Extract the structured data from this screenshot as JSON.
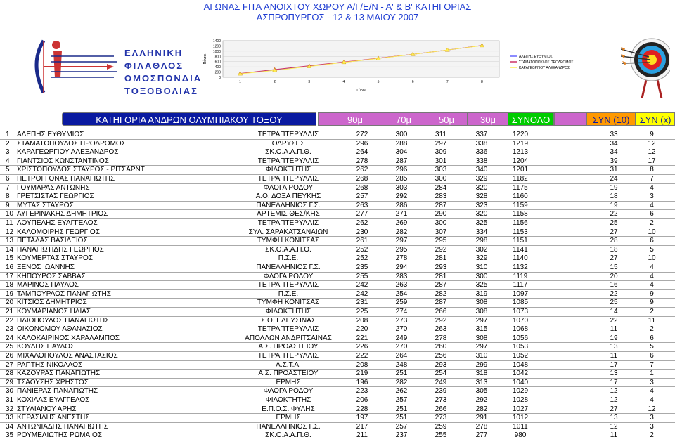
{
  "header": {
    "line1": "ΑΓΩΝΑΣ FITA ΑΝΟΙΧΤΟΥ ΧΩΡΟΥ Α/Γ/Ε/Ν - Α' & Β' ΚΑΤΗΓΟΡΙΑΣ",
    "line2": "ΑΣΠΡΟΠΥΡΓΟΣ - 12 & 13 ΜΑΙΟΥ 2007"
  },
  "logo": {
    "line1": "ΕΛΛΗΝΙΚΗ",
    "line2": "ΦΙΛΑΘΛΟΣ",
    "line3": "ΟΜΟΣΠΟΝΔΙΑ",
    "line4": "ΤΟΞΟΒΟΛΙΑΣ"
  },
  "colors": {
    "title": "#1e3cd2",
    "category_bg": "#0a1aa0",
    "category_text": "#ffffff",
    "distance_bg": "#cc66cc",
    "distance_text": "#ffffff",
    "total_bg": "#00cc00",
    "x10_bg": "#ff9900",
    "x_bg": "#ffff00"
  },
  "columns": {
    "category": "ΚΑΤΗΓΟΡΙΑ ΑΝΔΡΩΝ ΟΛΥΜΠΙΑΚΟΥ ΤΟΞΟΥ",
    "d90": "90μ",
    "d70": "70μ",
    "d50": "50μ",
    "d30": "30μ",
    "total": "ΣΥΝΟΛΟ",
    "x10": "ΣΥΝ (10)",
    "x": "ΣΥΝ (x)"
  },
  "chart_data": {
    "type": "line",
    "xlabel": "Γύροι",
    "ylabel": "Πόντοι",
    "ylim": [
      0,
      1400
    ],
    "yticks": [
      "0",
      "200",
      "400",
      "600",
      "800",
      "1000",
      "1200",
      "1400"
    ],
    "categories": [
      "1",
      "2",
      "3",
      "4",
      "5",
      "6",
      "7",
      "8"
    ],
    "series": [
      {
        "name": "ΑΛΕΠΗΣ ΕΥΘΥΜΙΟΣ",
        "color": "#6666ff",
        "values": [
          140,
          272,
          420,
          572,
          723,
          883,
          1043,
          1220
        ]
      },
      {
        "name": "ΣΤΑΜΑΤΟΠΟΥΛΟΣ ΠΡΟΔΡΟΜΟΣ",
        "color": "#cc3366",
        "values": [
          145,
          296,
          440,
          584,
          730,
          881,
          1045,
          1219
        ]
      },
      {
        "name": "ΚΑΡΑΓΕΩΡΓΙΟΥ ΑΛΕΞΑΝΔΡΟΣ",
        "color": "#ffee55",
        "values": [
          130,
          264,
          415,
          568,
          720,
          877,
          1045,
          1213
        ]
      }
    ]
  },
  "rows": [
    {
      "rank": "1",
      "name": "ΑΛΕΠΗΣ ΕΥΘΥΜΙΟΣ",
      "club": "ΤΕΤΡΑΠΤΕΡΥΛΛΙΣ",
      "s1": "272",
      "s2": "300",
      "s3": "311",
      "s4": "337",
      "total": "1220",
      "x10": "33",
      "x": "9"
    },
    {
      "rank": "2",
      "name": "ΣΤΑΜΑΤΟΠΟΥΛΟΣ ΠΡΟΔΡΟΜΟΣ",
      "club": "ΟΔΡΥΣΕΣ",
      "s1": "296",
      "s2": "288",
      "s3": "297",
      "s4": "338",
      "total": "1219",
      "x10": "34",
      "x": "12"
    },
    {
      "rank": "3",
      "name": "ΚΑΡΑΓΕΩΡΓΙΟΥ ΑΛΕΞΑΝΔΡΟΣ",
      "club": "ΣΚ.Ο.Α.Α.Π.Θ.",
      "s1": "264",
      "s2": "304",
      "s3": "309",
      "s4": "336",
      "total": "1213",
      "x10": "34",
      "x": "12"
    },
    {
      "rank": "4",
      "name": "ΓΙΑΝΤΣΙΟΣ ΚΩΝΣΤΑΝΤΙΝΟΣ",
      "club": "ΤΕΤΡΑΠΤΕΡΥΛΛΙΣ",
      "s1": "278",
      "s2": "287",
      "s3": "301",
      "s4": "338",
      "total": "1204",
      "x10": "39",
      "x": "17"
    },
    {
      "rank": "5",
      "name": "ΧΡΙΣΤΟΠΟΥΛΟΣ ΣΤΑΥΡΟΣ - ΡΙΤΣΑΡΝΤ",
      "club": "ΦΙΛΟΚΤΗΤΗΣ",
      "s1": "262",
      "s2": "296",
      "s3": "303",
      "s4": "340",
      "total": "1201",
      "x10": "31",
      "x": "8"
    },
    {
      "rank": "6",
      "name": "ΠΕΤΡΟΓΓΟΝΑΣ ΠΑΝΑΓΙΩΤΗΣ",
      "club": "ΤΕΤΡΑΠΤΕΡΥΛΛΙΣ",
      "s1": "268",
      "s2": "285",
      "s3": "300",
      "s4": "329",
      "total": "1182",
      "x10": "24",
      "x": "7"
    },
    {
      "rank": "7",
      "name": "ΓΟΥΜΑΡΑΣ ΑΝΤΩΝΗΣ",
      "club": "ΦΛΟΓΑ ΡΟΔΟΥ",
      "s1": "268",
      "s2": "303",
      "s3": "284",
      "s4": "320",
      "total": "1175",
      "x10": "19",
      "x": "4"
    },
    {
      "rank": "8",
      "name": "ΓΡΕΤΣΙΣΤΑΣ ΓΕΩΡΓΙΟΣ",
      "club": "Α.Ο. ΔΟΞΑ ΠΕΥΚΗΣ",
      "s1": "257",
      "s2": "292",
      "s3": "283",
      "s4": "328",
      "total": "1160",
      "x10": "18",
      "x": "3"
    },
    {
      "rank": "9",
      "name": "ΜΥΤΑΣ ΣΤΑΥΡΟΣ",
      "club": "ΠΑΝΕΛΛΗΝΙΟΣ Γ.Σ.",
      "s1": "263",
      "s2": "286",
      "s3": "287",
      "s4": "323",
      "total": "1159",
      "x10": "19",
      "x": "4"
    },
    {
      "rank": "10",
      "name": "ΑΥΓΕΡΙΝΑΚΗΣ ΔΗΜΗΤΡΙΟΣ",
      "club": "ΑΡΤΕΜΙΣ ΘΕΣ/ΚΗΣ",
      "s1": "277",
      "s2": "271",
      "s3": "290",
      "s4": "320",
      "total": "1158",
      "x10": "22",
      "x": "6"
    },
    {
      "rank": "11",
      "name": "ΛΟΥΠΕΛΗΣ ΕΥΑΓΓΕΛΟΣ",
      "club": "ΤΕΤΡΑΠΤΕΡΥΛΛΙΣ",
      "s1": "262",
      "s2": "269",
      "s3": "300",
      "s4": "325",
      "total": "1156",
      "x10": "25",
      "x": "2"
    },
    {
      "rank": "12",
      "name": "ΚΑΛΟΜΟΙΡΗΣ ΓΕΩΡΓΙΟΣ",
      "club": "ΣΥΛ. ΣΑΡΑΚΑΤΣΑΝΑΙΩΝ",
      "s1": "230",
      "s2": "282",
      "s3": "307",
      "s4": "334",
      "total": "1153",
      "x10": "27",
      "x": "10"
    },
    {
      "rank": "13",
      "name": "ΠΕΤΑΛΑΣ ΒΑΣΙΛΕΙΟΣ",
      "club": "ΤΥΜΦΗ ΚΟΝΙΤΣΑΣ",
      "s1": "261",
      "s2": "297",
      "s3": "295",
      "s4": "298",
      "total": "1151",
      "x10": "28",
      "x": "6"
    },
    {
      "rank": "14",
      "name": "ΠΑΝΑΓΙΩΤΙΔΗΣ ΓΕΩΡΓΙΟΣ",
      "club": "ΣΚ.Ο.Α.Α.Π.Θ.",
      "s1": "252",
      "s2": "295",
      "s3": "292",
      "s4": "302",
      "total": "1141",
      "x10": "18",
      "x": "5"
    },
    {
      "rank": "15",
      "name": "ΚΟΥΜΕΡΤΑΣ ΣΤΑΥΡΟΣ",
      "club": "Π.Σ.Ε.",
      "s1": "252",
      "s2": "278",
      "s3": "281",
      "s4": "329",
      "total": "1140",
      "x10": "27",
      "x": "10"
    },
    {
      "rank": "16",
      "name": "ΞΕΝΟΣ ΙΩΑΝΝΗΣ",
      "club": "ΠΑΝΕΛΛΗΝΙΟΣ Γ.Σ.",
      "s1": "235",
      "s2": "294",
      "s3": "293",
      "s4": "310",
      "total": "1132",
      "x10": "15",
      "x": "4"
    },
    {
      "rank": "17",
      "name": "ΚΗΠΟΥΡΟΣ ΣΑΒΒΑΣ",
      "club": "ΦΛΟΓΑ ΡΟΔΟΥ",
      "s1": "255",
      "s2": "283",
      "s3": "281",
      "s4": "300",
      "total": "1119",
      "x10": "20",
      "x": "4"
    },
    {
      "rank": "18",
      "name": "ΜΑΡΙΝΟΣ ΠΑΥΛΟΣ",
      "club": "ΤΕΤΡΑΠΤΕΡΥΛΛΙΣ",
      "s1": "242",
      "s2": "263",
      "s3": "287",
      "s4": "325",
      "total": "1117",
      "x10": "16",
      "x": "4"
    },
    {
      "rank": "19",
      "name": "ΤΑΜΠΟΥΡΛΟΣ ΠΑΝΑΓΙΩΤΗΣ",
      "club": "Π.Σ.Ε.",
      "s1": "242",
      "s2": "254",
      "s3": "282",
      "s4": "319",
      "total": "1097",
      "x10": "22",
      "x": "9"
    },
    {
      "rank": "20",
      "name": "ΚΙΤΣΙΟΣ ΔΗΜΗΤΡΙΟΣ",
      "club": "ΤΥΜΦΗ ΚΟΝΙΤΣΑΣ",
      "s1": "231",
      "s2": "259",
      "s3": "287",
      "s4": "308",
      "total": "1085",
      "x10": "25",
      "x": "9"
    },
    {
      "rank": "21",
      "name": "ΚΟΥΜΑΡΙΑΝΟΣ ΗΛΙΑΣ",
      "club": "ΦΙΛΟΚΤΗΤΗΣ",
      "s1": "225",
      "s2": "274",
      "s3": "266",
      "s4": "308",
      "total": "1073",
      "x10": "14",
      "x": "2"
    },
    {
      "rank": "22",
      "name": "ΗΛΙΟΠΟΥΛΟΣ ΠΑΝΑΓΙΩΤΗΣ",
      "club": "Σ.Ο. ΕΛΕΥΣΙΝΑΣ",
      "s1": "208",
      "s2": "273",
      "s3": "292",
      "s4": "297",
      "total": "1070",
      "x10": "22",
      "x": "11"
    },
    {
      "rank": "23",
      "name": "ΟΙΚΟΝΟΜΟΥ ΑΘΑΝΑΣΙΟΣ",
      "club": "ΤΕΤΡΑΠΤΕΡΥΛΛΙΣ",
      "s1": "220",
      "s2": "270",
      "s3": "263",
      "s4": "315",
      "total": "1068",
      "x10": "11",
      "x": "2"
    },
    {
      "rank": "24",
      "name": "ΚΑΛΟΚΑΙΡΙΝΟΣ ΧΑΡΑΛΑΜΠΟΣ",
      "club": "ΑΠΟΛΛΩΝ ΑΝΔΡΙΤΣΑΙΝΑΣ",
      "s1": "221",
      "s2": "249",
      "s3": "278",
      "s4": "308",
      "total": "1056",
      "x10": "19",
      "x": "6"
    },
    {
      "rank": "25",
      "name": "ΚΟΥΛΗΣ ΠΑΥΛΟΣ",
      "club": "Α.Σ. ΠΡΟΑΣΤΕΙΟΥ",
      "s1": "226",
      "s2": "270",
      "s3": "260",
      "s4": "297",
      "total": "1053",
      "x10": "13",
      "x": "5"
    },
    {
      "rank": "26",
      "name": "ΜΙΧΑΛΟΠΟΥΛΟΣ ΑΝΑΣΤΑΣΙΟΣ",
      "club": "ΤΕΤΡΑΠΤΕΡΥΛΛΙΣ",
      "s1": "222",
      "s2": "264",
      "s3": "256",
      "s4": "310",
      "total": "1052",
      "x10": "11",
      "x": "6"
    },
    {
      "rank": "27",
      "name": "ΡΑΠΤΗΣ ΝΙΚΟΛΑΟΣ",
      "club": "Α.Σ.Τ.Α.",
      "s1": "208",
      "s2": "248",
      "s3": "293",
      "s4": "299",
      "total": "1048",
      "x10": "17",
      "x": "7"
    },
    {
      "rank": "28",
      "name": "ΚΑΖΟΥΡΑΣ ΠΑΝΑΓΙΩΤΗΣ",
      "club": "Α.Σ. ΠΡΟΑΣΤΕΙΟΥ",
      "s1": "219",
      "s2": "251",
      "s3": "254",
      "s4": "318",
      "total": "1042",
      "x10": "13",
      "x": "1"
    },
    {
      "rank": "29",
      "name": "ΤΣΑΟΥΣΗΣ ΧΡΗΣΤΟΣ",
      "club": "ΕΡΜΗΣ",
      "s1": "196",
      "s2": "282",
      "s3": "249",
      "s4": "313",
      "total": "1040",
      "x10": "17",
      "x": "3"
    },
    {
      "rank": "30",
      "name": "ΠΑΝΙΕΡΑΣ ΠΑΝΑΓΙΩΤΗΣ",
      "club": "ΦΛΟΓΑ ΡΟΔΟΥ",
      "s1": "223",
      "s2": "262",
      "s3": "239",
      "s4": "305",
      "total": "1029",
      "x10": "12",
      "x": "4"
    },
    {
      "rank": "31",
      "name": "ΚΟΧΙΛΑΣ ΕΥΑΓΓΕΛΟΣ",
      "club": "ΦΙΛΟΚΤΗΤΗΣ",
      "s1": "206",
      "s2": "257",
      "s3": "273",
      "s4": "292",
      "total": "1028",
      "x10": "12",
      "x": "4"
    },
    {
      "rank": "32",
      "name": "ΣΤΥΛΙΑΝΟΥ ΑΡΗΣ",
      "club": "Ε.Π.Ο.Σ. ΦΥΛΗΣ",
      "s1": "228",
      "s2": "251",
      "s3": "266",
      "s4": "282",
      "total": "1027",
      "x10": "27",
      "x": "12"
    },
    {
      "rank": "33",
      "name": "ΚΕΡΑΣΙΔΗΣ ΑΝΕΣΤΗΣ",
      "club": "ΕΡΜΗΣ",
      "s1": "197",
      "s2": "251",
      "s3": "273",
      "s4": "291",
      "total": "1012",
      "x10": "13",
      "x": "3"
    },
    {
      "rank": "34",
      "name": "ΑΝΤΩΝΙΑΔΗΣ ΠΑΝΑΓΙΩΤΗΣ",
      "club": "ΠΑΝΕΛΛΗΝΙΟΣ Γ.Σ.",
      "s1": "217",
      "s2": "257",
      "s3": "259",
      "s4": "278",
      "total": "1011",
      "x10": "12",
      "x": "3"
    },
    {
      "rank": "35",
      "name": "ΡΟΥΜΕΛΙΩΤΗΣ ΡΩΜΑΙΟΣ",
      "club": "ΣΚ.Ο.Α.Α.Π.Θ.",
      "s1": "211",
      "s2": "237",
      "s3": "255",
      "s4": "277",
      "total": "980",
      "x10": "11",
      "x": "2"
    }
  ]
}
